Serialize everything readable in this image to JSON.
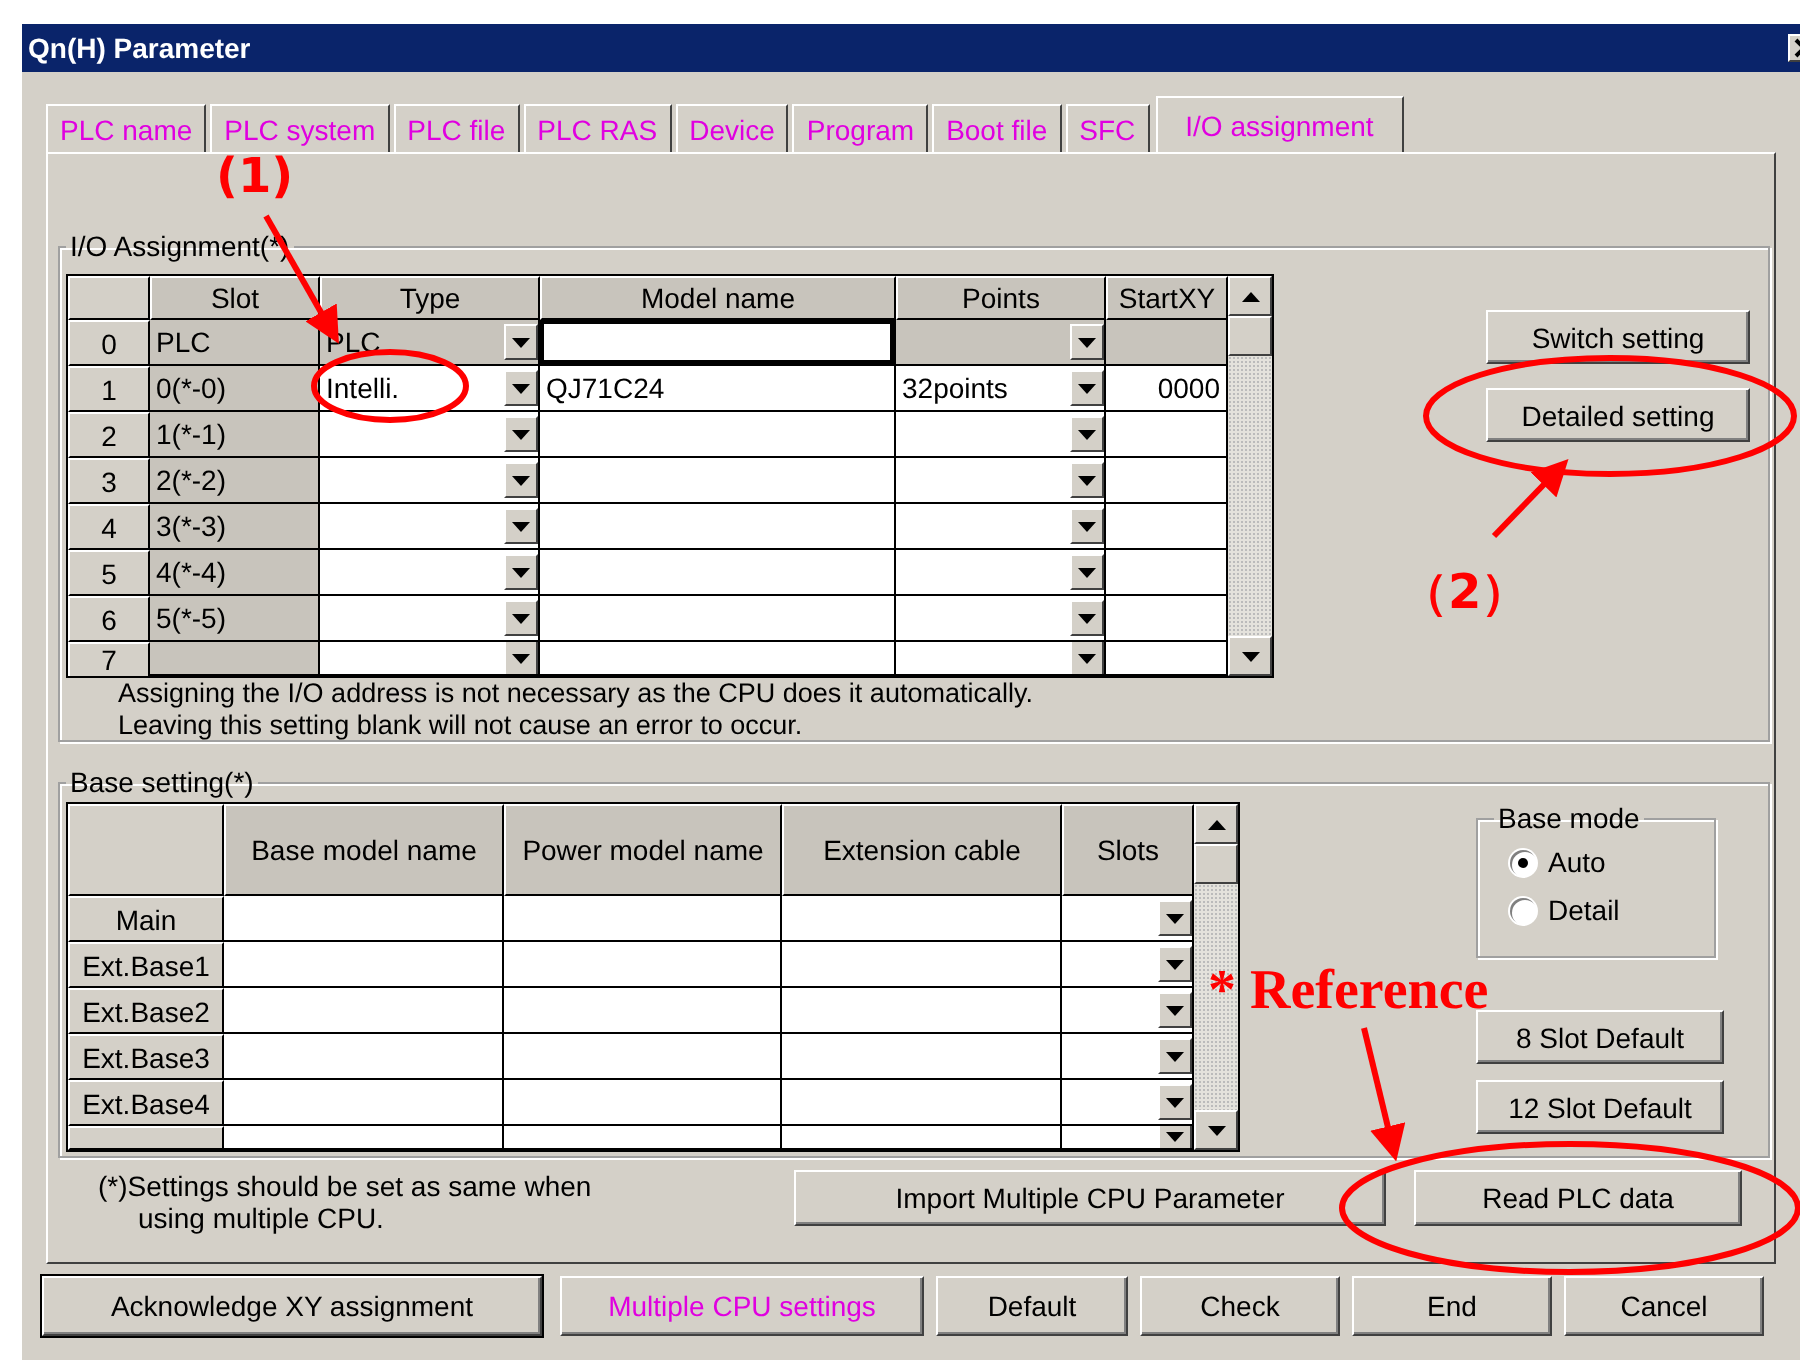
{
  "window": {
    "title": "Qn(H) Parameter"
  },
  "tabs": [
    {
      "label": "PLC name",
      "selected": false
    },
    {
      "label": "PLC system",
      "selected": false
    },
    {
      "label": "PLC file",
      "selected": false
    },
    {
      "label": "PLC RAS",
      "selected": false
    },
    {
      "label": "Device",
      "selected": false
    },
    {
      "label": "Program",
      "selected": false
    },
    {
      "label": "Boot file",
      "selected": false
    },
    {
      "label": "SFC",
      "selected": false
    },
    {
      "label": "I/O assignment",
      "selected": true
    }
  ],
  "io_assignment": {
    "title": "I/O Assignment(*)",
    "columns": [
      "Slot",
      "Type",
      "Model name",
      "Points",
      "StartXY"
    ],
    "rows": [
      {
        "no": "0",
        "slot": "PLC",
        "type": "PLC",
        "disabled": true
      },
      {
        "no": "1",
        "slot": "0(*-0)",
        "type": "Intelli.",
        "model": "QJ71C24",
        "points": "32points",
        "start": "0000",
        "disabled": false
      },
      {
        "no": "2",
        "slot": "1(*-1)",
        "disabled": false
      },
      {
        "no": "3",
        "slot": "2(*-2)",
        "disabled": false
      },
      {
        "no": "4",
        "slot": "3(*-3)",
        "disabled": false
      },
      {
        "no": "5",
        "slot": "4(*-4)",
        "disabled": false
      },
      {
        "no": "6",
        "slot": "5(*-5)",
        "disabled": false
      },
      {
        "no": "7",
        "disabled": false
      }
    ],
    "note": [
      "Assigning the I/O address is not necessary as the CPU does it automatically.",
      "Leaving this setting blank will not cause an error to occur."
    ],
    "buttons": [
      "Switch setting",
      "Detailed setting"
    ]
  },
  "base_setting": {
    "title": "Base setting(*)",
    "columns": [
      "Base model name",
      "Power model name",
      "Extension cable",
      "Slots"
    ],
    "rows": [
      "Main",
      "Ext.Base1",
      "Ext.Base2",
      "Ext.Base3",
      "Ext.Base4",
      ""
    ],
    "base_mode": {
      "title": "Base mode",
      "options": [
        {
          "label": "Auto",
          "selected": true
        },
        {
          "label": "Detail",
          "selected": false
        }
      ]
    },
    "buttons": [
      "8 Slot Default",
      "12 Slot Default"
    ]
  },
  "footnote": [
    "(*)Settings should be set as same when",
    "using multiple CPU."
  ],
  "mid_buttons": [
    "Import Multiple CPU Parameter",
    "Read PLC data"
  ],
  "bottom_buttons": [
    {
      "label": "Acknowledge XY assignment",
      "kind": "default"
    },
    {
      "label": "Multiple CPU settings",
      "kind": "highlight"
    },
    {
      "label": "Default",
      "kind": "normal"
    },
    {
      "label": "Check",
      "kind": "normal"
    },
    {
      "label": "End",
      "kind": "normal"
    },
    {
      "label": "Cancel",
      "kind": "normal"
    }
  ],
  "annotations": [
    {
      "kind": "step",
      "text": "(1)"
    },
    {
      "kind": "step",
      "text": "（2）"
    },
    {
      "kind": "note",
      "text": "* Reference"
    }
  ]
}
